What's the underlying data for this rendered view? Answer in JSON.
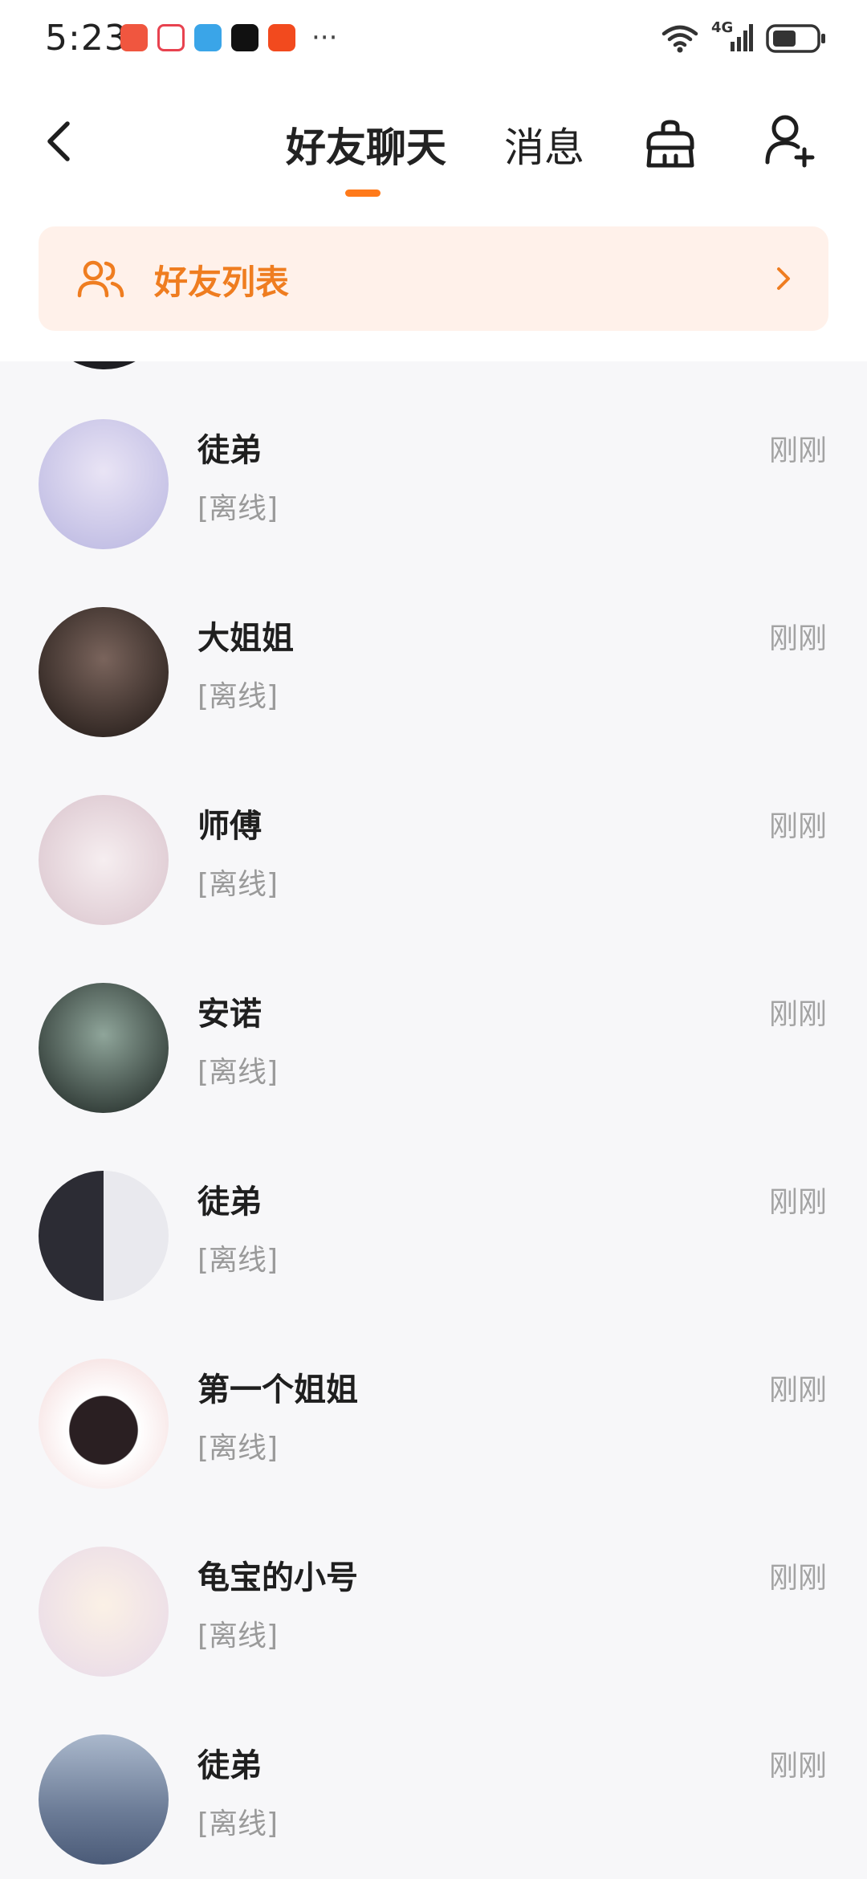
{
  "status_bar": {
    "time": "5:23",
    "overflow": "···",
    "network": "4G",
    "notification_icons": [
      {
        "name": "app-red-icon",
        "color": "#f0563f"
      },
      {
        "name": "app-red-heart-icon",
        "color": "#e8424f"
      },
      {
        "name": "app-blue-icon",
        "color": "#3aa5e8"
      },
      {
        "name": "tiktok-icon",
        "color": "#111111"
      },
      {
        "name": "taobao-icon",
        "color": "#f24a1e"
      }
    ]
  },
  "header": {
    "tabs": [
      {
        "label": "好友聊天",
        "active": true
      },
      {
        "label": "消息",
        "active": false
      }
    ],
    "accent_color": "#ff7a1a"
  },
  "banner": {
    "label": "好友列表",
    "color": "#ef7d20",
    "background": "#fff1ea"
  },
  "chats": [
    {
      "name": "徒弟",
      "status": "[离线]",
      "time": "刚刚",
      "avatar_color": [
        "#e9e4f5",
        "#b8b5e0"
      ]
    },
    {
      "name": "大姐姐",
      "status": "[离线]",
      "time": "刚刚",
      "avatar_color": [
        "#4a3a36",
        "#1e1714"
      ]
    },
    {
      "name": "师傅",
      "status": "[离线]",
      "time": "刚刚",
      "avatar_color": [
        "#f6eef0",
        "#d9c3cc"
      ]
    },
    {
      "name": "安诺",
      "status": "[离线]",
      "time": "刚刚",
      "avatar_color": [
        "#5c6e66",
        "#1b2320"
      ]
    },
    {
      "name": "徒弟",
      "status": "[离线]",
      "time": "刚刚",
      "avatar_color": [
        "#e9e9ee",
        "#2c2c34"
      ]
    },
    {
      "name": "第一个姐姐",
      "status": "[离线]",
      "time": "刚刚",
      "avatar_color": [
        "#ffffff",
        "#d43a3a"
      ]
    },
    {
      "name": "龟宝的小号",
      "status": "[离线]",
      "time": "刚刚",
      "avatar_color": [
        "#fbf1e6",
        "#e7d8e8"
      ]
    },
    {
      "name": "徒弟",
      "status": "[离线]",
      "time": "刚刚",
      "avatar_color": [
        "#aab8cc",
        "#4b5b78"
      ]
    }
  ]
}
